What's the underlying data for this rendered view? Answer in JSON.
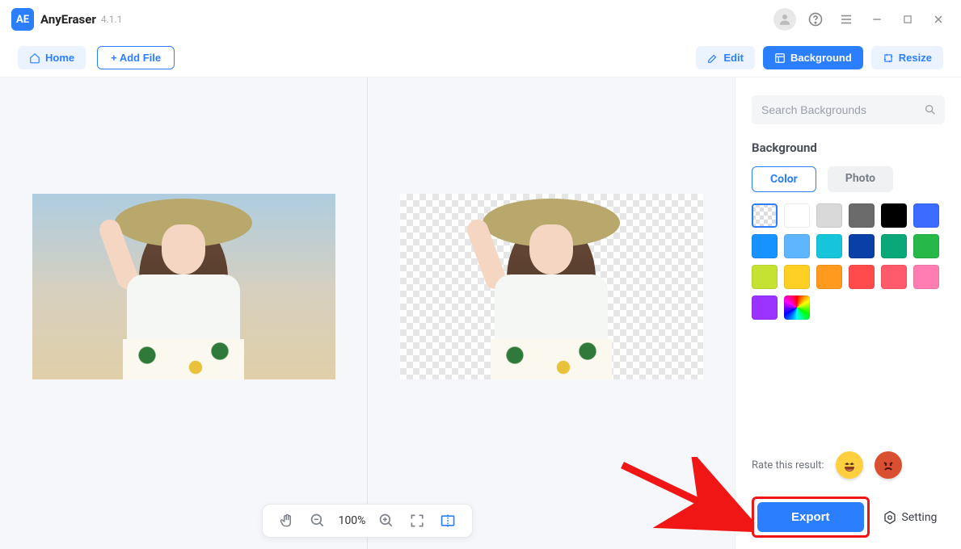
{
  "app": {
    "name": "AnyEraser",
    "version": "4.1.1"
  },
  "toolbar": {
    "home": "Home",
    "add_file": "+ Add File",
    "edit": "Edit",
    "background": "Background",
    "resize": "Resize"
  },
  "sidebar": {
    "search_placeholder": "Search Backgrounds",
    "section_title": "Background",
    "tab_color": "Color",
    "tab_photo": "Photo",
    "swatches": [
      {
        "name": "transparent",
        "css": "transparent"
      },
      {
        "name": "white",
        "css": "#ffffff"
      },
      {
        "name": "light-gray",
        "css": "#d9d9d9"
      },
      {
        "name": "dark-gray",
        "css": "#6b6b6b"
      },
      {
        "name": "black",
        "css": "#000000"
      },
      {
        "name": "blue",
        "css": "#3b6bff"
      },
      {
        "name": "sky-blue",
        "css": "#1793ff"
      },
      {
        "name": "light-blue",
        "css": "#5fb6ff"
      },
      {
        "name": "cyan",
        "css": "#16c5d9"
      },
      {
        "name": "navy",
        "css": "#0a3fa8"
      },
      {
        "name": "teal",
        "css": "#0aa878"
      },
      {
        "name": "green",
        "css": "#27b84a"
      },
      {
        "name": "lime",
        "css": "#c5e233"
      },
      {
        "name": "yellow",
        "css": "#ffd024"
      },
      {
        "name": "orange",
        "css": "#ff9a1f"
      },
      {
        "name": "red",
        "css": "#ff4b4b"
      },
      {
        "name": "coral",
        "css": "#ff5a6b"
      },
      {
        "name": "pink",
        "css": "#ff7db0"
      },
      {
        "name": "purple",
        "css": "#9a33ff"
      },
      {
        "name": "rainbow",
        "css": "rainbow"
      }
    ],
    "rate_label": "Rate this result:",
    "export": "Export",
    "setting": "Setting"
  },
  "zoom": {
    "level": "100%"
  }
}
